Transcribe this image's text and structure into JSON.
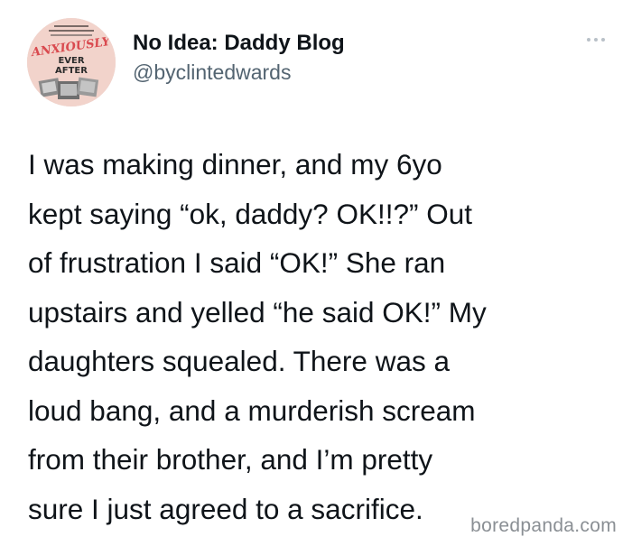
{
  "author": {
    "display_name": "No Idea: Daddy Blog",
    "handle": "@byclintedwards",
    "avatar": {
      "logo_text_top": "ANXIOUSLY",
      "logo_text_middle": "EVER",
      "logo_text_bottom": "AFTER",
      "brand_color": "#d94a4f"
    }
  },
  "more_button": {
    "icon": "more-dots-icon"
  },
  "tweet": {
    "lines": [
      "I was making dinner, and my 6yo",
      "kept saying “ok, daddy? OK!!?” Out",
      "of frustration I said “OK!” She ran",
      "upstairs and yelled “he said OK!” My",
      "daughters squealed. There was a",
      "loud bang, and a murderish scream",
      "from their brother, and I’m pretty",
      "sure I just agreed to a sacrifice."
    ]
  },
  "watermark": "boredpanda.com",
  "colors": {
    "text": "#0f1419",
    "secondary": "#536471",
    "background": "#ffffff"
  }
}
